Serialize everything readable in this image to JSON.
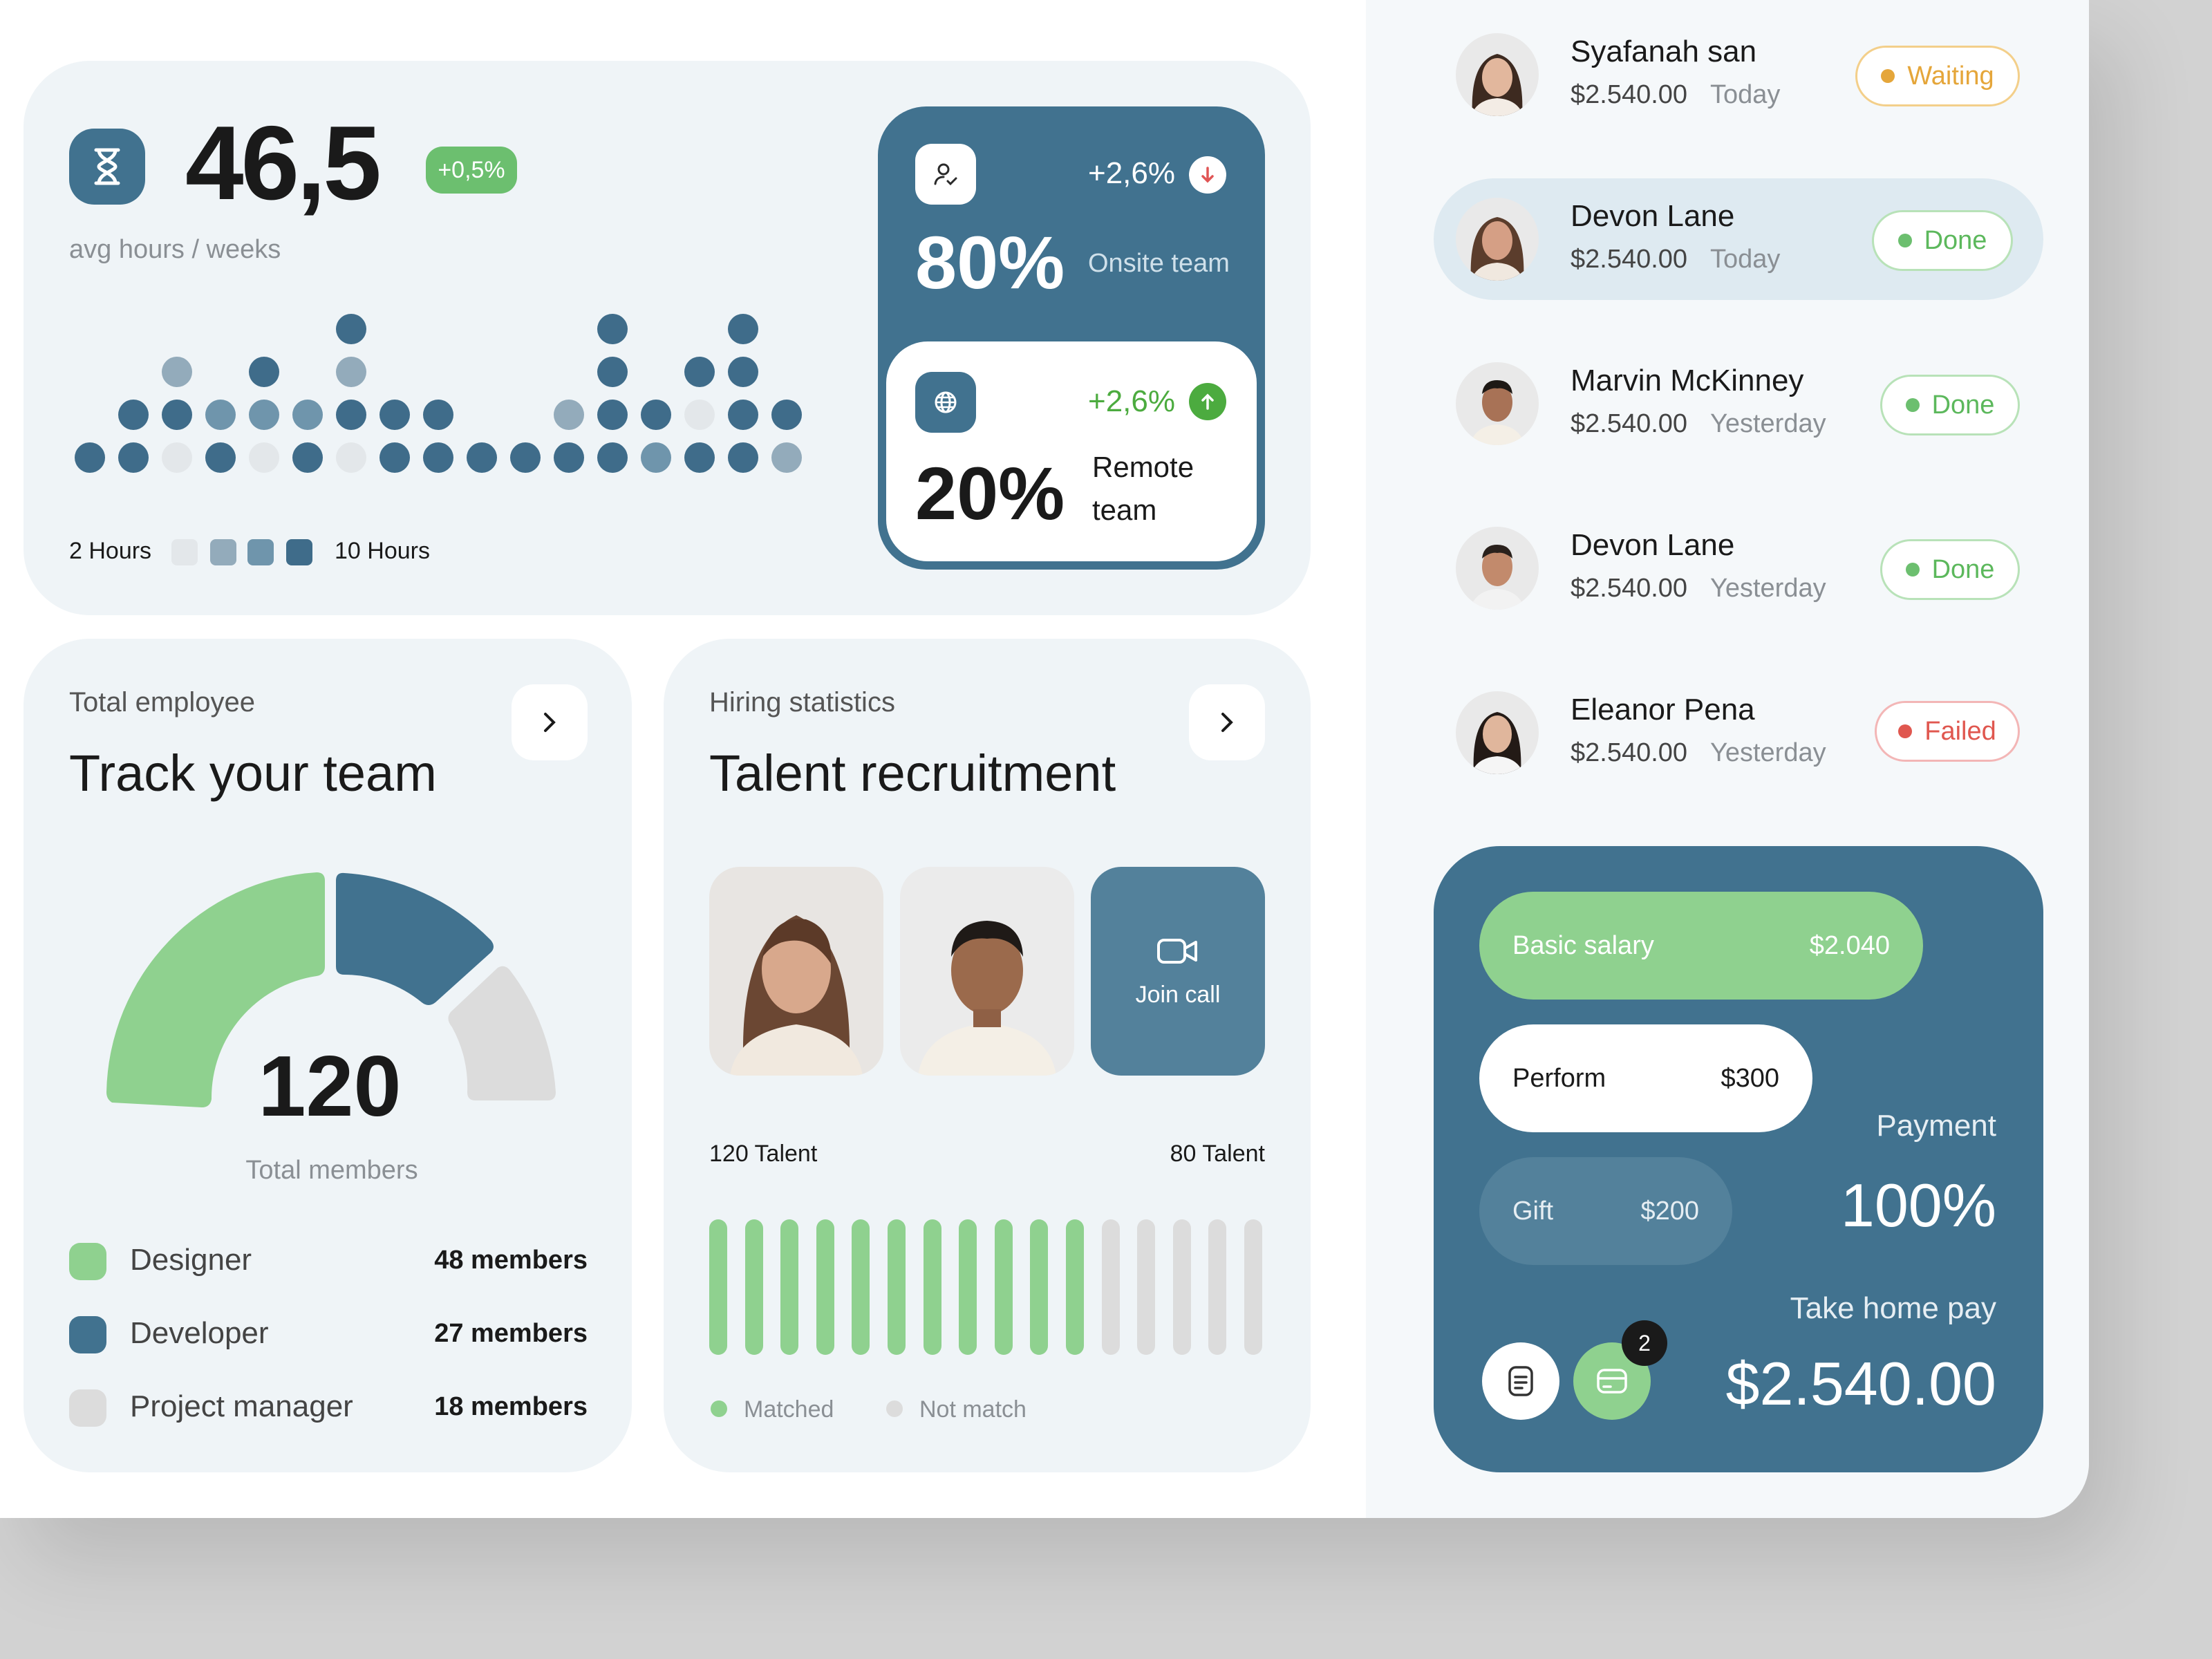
{
  "hours": {
    "value": "46,5",
    "delta": "+0,5%",
    "caption": "avg hours / weeks",
    "legend_min": "2 Hours",
    "legend_max": "10 Hours",
    "scale_colors": [
      "#e3e7ea",
      "#93abbb",
      "#6f95ac",
      "#3f6c8a"
    ]
  },
  "team_split": {
    "onsite_delta": "+2,6%",
    "onsite_value": "80%",
    "onsite_label": "Onsite team",
    "remote_delta": "+2,6%",
    "remote_value": "20%",
    "remote_label_1": "Remote",
    "remote_label_2": "team"
  },
  "employee_card": {
    "eyebrow": "Total employee",
    "title": "Track your team",
    "total": "120",
    "total_label": "Total members",
    "groups": [
      {
        "name": "Designer",
        "count": "48 members",
        "color": "#8fd18f"
      },
      {
        "name": "Developer",
        "count": "27 members",
        "color": "#41728f"
      },
      {
        "name": "Project manager",
        "count": "18 members",
        "color": "#dcdcdc"
      }
    ]
  },
  "hiring_card": {
    "eyebrow": "Hiring statistics",
    "title": "Talent recruitment",
    "join_call": "Join call",
    "left_count": "120 Talent",
    "right_count": "80 Talent",
    "matched_label": "Matched",
    "not_match_label": "Not match",
    "matched_bars": 11,
    "total_bars": 16,
    "matched_color": "#8fd18f",
    "not_match_color": "#dcdcdc"
  },
  "people": [
    {
      "name": "Syafanah san",
      "amount": "$2.540.00",
      "when": "Today",
      "status": "Waiting"
    },
    {
      "name": "Devon Lane",
      "amount": "$2.540.00",
      "when": "Today",
      "status": "Done"
    },
    {
      "name": "Marvin McKinney",
      "amount": "$2.540.00",
      "when": "Yesterday",
      "status": "Done"
    },
    {
      "name": "Devon Lane",
      "amount": "$2.540.00",
      "when": "Yesterday",
      "status": "Done"
    },
    {
      "name": "Eleanor Pena",
      "amount": "$2.540.00",
      "when": "Yesterday",
      "status": "Failed"
    }
  ],
  "payment": {
    "basic_label": "Basic salary",
    "basic_value": "$2.040",
    "perform_label": "Perform",
    "perform_value": "$300",
    "gift_label": "Gift",
    "gift_value": "$200",
    "payment_label": "Payment",
    "payment_value": "100%",
    "take_home_label": "Take home pay",
    "take_home_value": "$2.540.00",
    "notification_count": "2"
  }
}
